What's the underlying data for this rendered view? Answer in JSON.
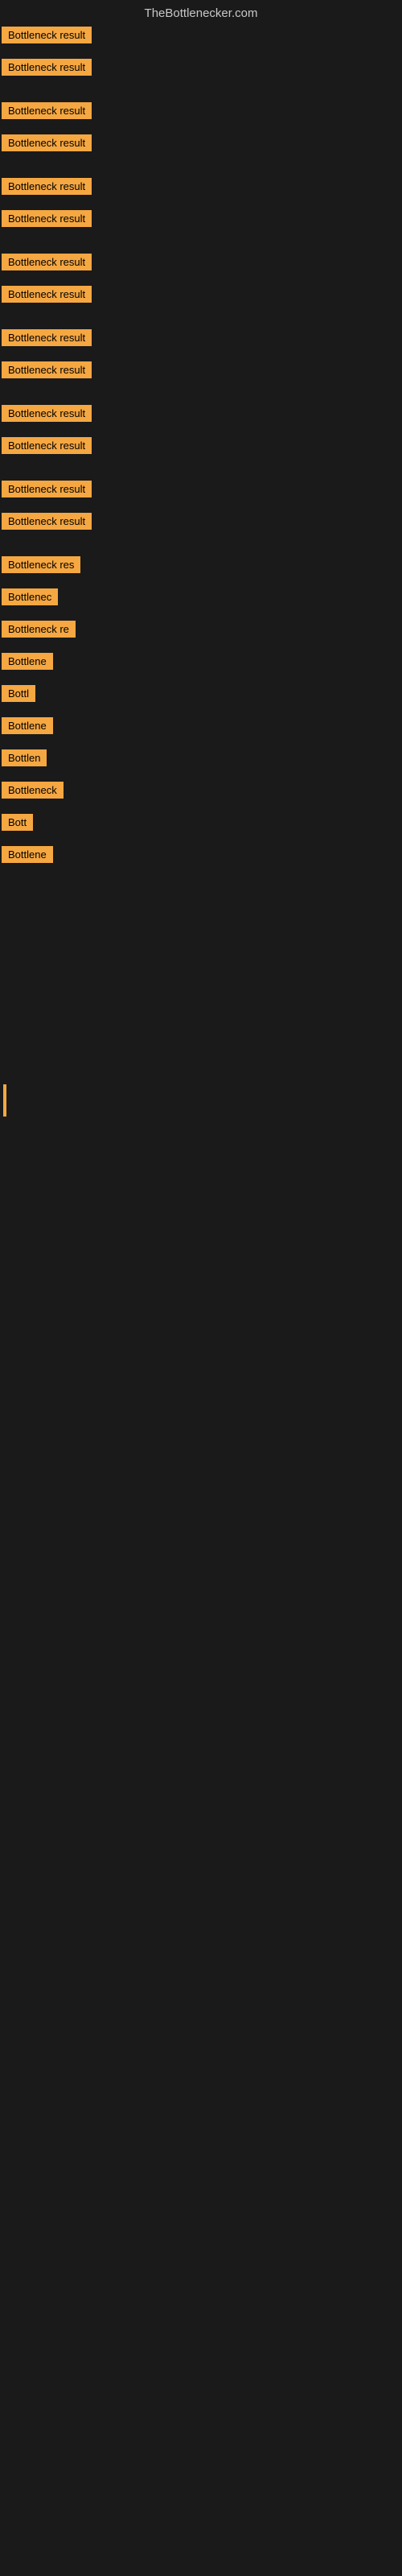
{
  "header": {
    "title": "TheBottlenecker.com"
  },
  "items": [
    {
      "id": 1,
      "label": "Bottleneck result",
      "width_class": "w-full",
      "gap_after": false
    },
    {
      "id": 2,
      "label": "Bottleneck result",
      "width_class": "w-full",
      "gap_after": false
    },
    {
      "id": 3,
      "label": "Bottleneck result",
      "width_class": "w-full",
      "gap_after": false
    },
    {
      "id": 4,
      "label": "Bottleneck result",
      "width_class": "w-full",
      "gap_after": false
    },
    {
      "id": 5,
      "label": "Bottleneck result",
      "width_class": "w-full",
      "gap_after": false
    },
    {
      "id": 6,
      "label": "Bottleneck result",
      "width_class": "w-full",
      "gap_after": false
    },
    {
      "id": 7,
      "label": "Bottleneck result",
      "width_class": "w-full",
      "gap_after": false
    },
    {
      "id": 8,
      "label": "Bottleneck result",
      "width_class": "w-full",
      "gap_after": false
    },
    {
      "id": 9,
      "label": "Bottleneck result",
      "width_class": "w-full",
      "gap_after": false
    },
    {
      "id": 10,
      "label": "Bottleneck result",
      "width_class": "w-full",
      "gap_after": false
    },
    {
      "id": 11,
      "label": "Bottleneck result",
      "width_class": "w-full",
      "gap_after": false
    },
    {
      "id": 12,
      "label": "Bottleneck result",
      "width_class": "w-full",
      "gap_after": false
    },
    {
      "id": 13,
      "label": "Bottleneck result",
      "width_class": "w-full",
      "gap_after": false
    },
    {
      "id": 14,
      "label": "Bottleneck result",
      "width_class": "w-full",
      "gap_after": false
    },
    {
      "id": 15,
      "label": "Bottleneck res",
      "width_class": "w-almost",
      "gap_after": false
    },
    {
      "id": 16,
      "label": "Bottlenec",
      "width_class": "w-med",
      "gap_after": false
    },
    {
      "id": 17,
      "label": "Bottleneck re",
      "width_class": "w-almost",
      "gap_after": false
    },
    {
      "id": 18,
      "label": "Bottlene",
      "width_class": "w-sm",
      "gap_after": false
    },
    {
      "id": 19,
      "label": "Bottl",
      "width_class": "w-xs",
      "gap_after": false
    },
    {
      "id": 20,
      "label": "Bottlene",
      "width_class": "w-sm",
      "gap_after": false
    },
    {
      "id": 21,
      "label": "Bottlen",
      "width_class": "w-xs",
      "gap_after": false
    },
    {
      "id": 22,
      "label": "Bottleneck",
      "width_class": "w-med",
      "gap_after": false
    },
    {
      "id": 23,
      "label": "Bott",
      "width_class": "w-xxs",
      "gap_after": false
    },
    {
      "id": 24,
      "label": "Bottlene",
      "width_class": "w-sm",
      "gap_after": false
    }
  ],
  "bottom_items": [
    {
      "id": 25,
      "label": "",
      "is_bar": true
    }
  ],
  "colors": {
    "background": "#1a1a1a",
    "label_bg": "#f5a742",
    "label_text": "#000000",
    "header_text": "#c8c8c8",
    "bar_color": "#f5a742"
  }
}
